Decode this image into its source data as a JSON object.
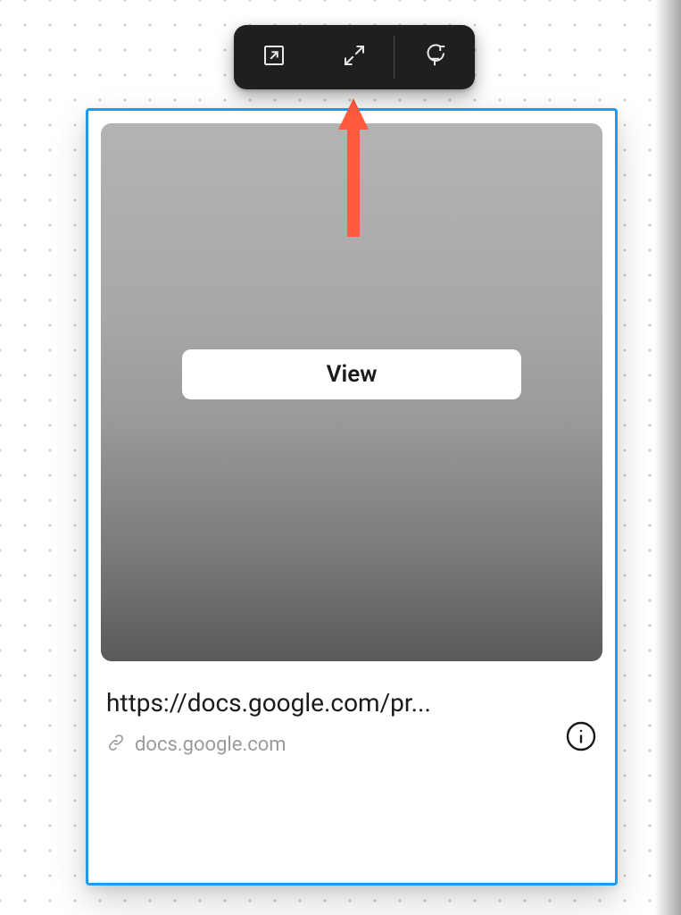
{
  "toolbar": {
    "open_external": "open-external",
    "expand": "expand",
    "reset_title": "reset-title"
  },
  "card": {
    "view_button_label": "View",
    "url_text": "https://docs.google.com/pr...",
    "domain": "docs.google.com"
  },
  "colors": {
    "selection": "#1e9bf0",
    "toolbar_bg": "#1f1f1f",
    "arrow": "#ff5a3d"
  }
}
